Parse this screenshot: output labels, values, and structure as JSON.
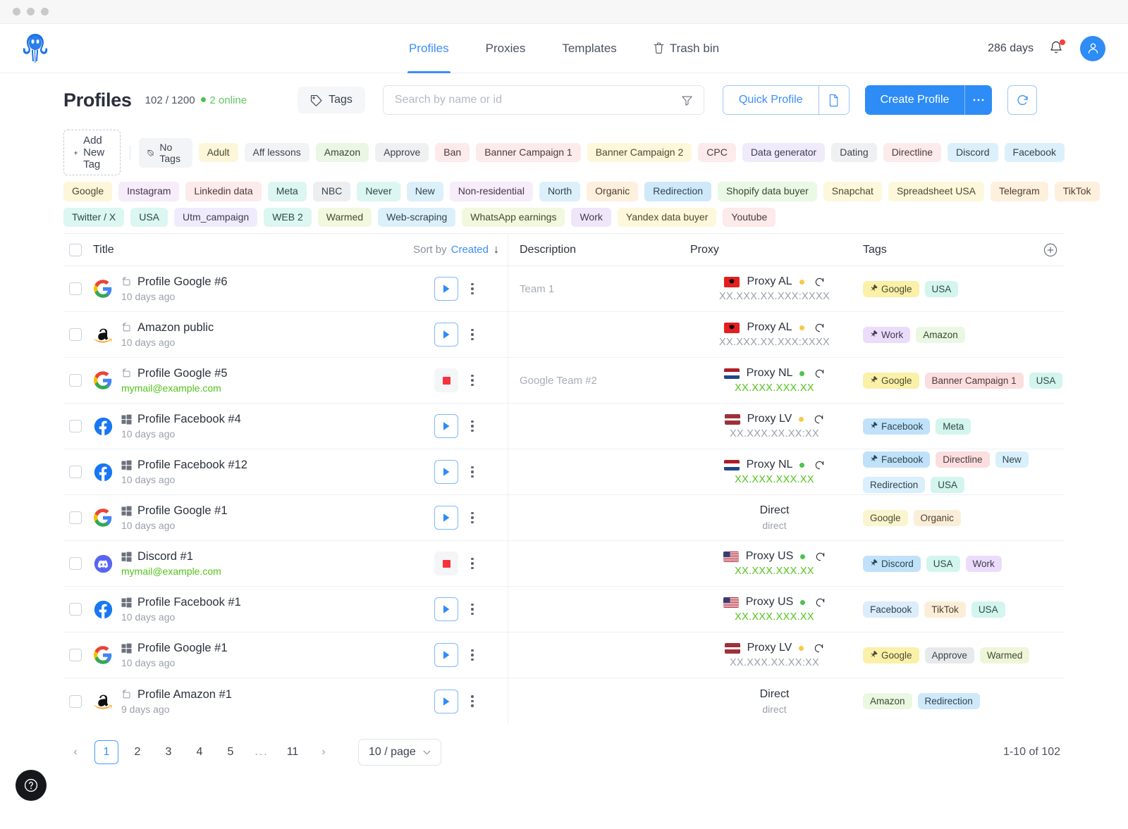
{
  "window": {
    "dots": 3
  },
  "nav": {
    "items": [
      {
        "label": "Profiles",
        "icon": "",
        "active": true
      },
      {
        "label": "Proxies",
        "icon": "",
        "active": false
      },
      {
        "label": "Templates",
        "icon": "",
        "active": false
      },
      {
        "label": "Trash bin",
        "icon": "trash-icon",
        "active": false
      }
    ],
    "days": "286 days",
    "bell_icon": "bell-icon",
    "avatar_icon": "user-icon",
    "logo_icon": "octopus-logo"
  },
  "header": {
    "title": "Profiles",
    "counts": "102 / 1200",
    "online": "2 online",
    "tags_button": "Tags",
    "tags_icon": "tag-icon",
    "search_placeholder": "Search by name or id",
    "search_value": "",
    "filter_icon": "filter-icon",
    "quick_profile": "Quick Profile",
    "quick_profile_icon": "document-icon",
    "create_profile": "Create Profile",
    "create_more_icon": "ellipsis-icon",
    "refresh_icon": "refresh-icon"
  },
  "tag_filters": {
    "add_new_tag": "Add New Tag",
    "add_icon": "plus-icon",
    "no_tags": "No Tags",
    "no_tags_icon": "no-tag-icon",
    "rows": [
      [
        {
          "label": "Adult",
          "bg": "#fdf6d9",
          "fg": "#4b4a32"
        },
        {
          "label": "Aff lessons",
          "bg": "#f2f3f5",
          "fg": "#3c4250"
        },
        {
          "label": "Amazon",
          "bg": "#e9f7e4",
          "fg": "#39482f"
        },
        {
          "label": "Approve",
          "bg": "#eef0f2",
          "fg": "#3c4250"
        },
        {
          "label": "Ban",
          "bg": "#fdeaea",
          "fg": "#50393a"
        },
        {
          "label": "Banner Campaign 1",
          "bg": "#fdeaea",
          "fg": "#50393a"
        },
        {
          "label": "Banner Campaign 2",
          "bg": "#fdf8db",
          "fg": "#4b4a32"
        },
        {
          "label": "CPC",
          "bg": "#fdeaea",
          "fg": "#50393a"
        },
        {
          "label": "Data generator",
          "bg": "#f0ebfb",
          "fg": "#3f3a50"
        },
        {
          "label": "Dating",
          "bg": "#eef0f2",
          "fg": "#3c4250"
        },
        {
          "label": "Directline",
          "bg": "#fdeaea",
          "fg": "#50393a"
        },
        {
          "label": "Discord",
          "bg": "#dcf0fb",
          "fg": "#2f444f"
        },
        {
          "label": "Facebook",
          "bg": "#dcf0fb",
          "fg": "#2f444f"
        }
      ],
      [
        {
          "label": "Google",
          "bg": "#fdf6d9",
          "fg": "#4b4a32"
        },
        {
          "label": "Instagram",
          "bg": "#f6ecfa",
          "fg": "#46354d"
        },
        {
          "label": "Linkedin data",
          "bg": "#fdeaea",
          "fg": "#50393a"
        },
        {
          "label": "Meta",
          "bg": "#dcf6f1",
          "fg": "#2c4a45"
        },
        {
          "label": "NBC",
          "bg": "#eceef0",
          "fg": "#3c4250"
        },
        {
          "label": "Never",
          "bg": "#dcf6f1",
          "fg": "#2c4a45"
        },
        {
          "label": "New",
          "bg": "#dcf0fb",
          "fg": "#2f444f"
        },
        {
          "label": "Non-residential",
          "bg": "#f6ecfa",
          "fg": "#46354d"
        },
        {
          "label": "North",
          "bg": "#dcf0fb",
          "fg": "#2f444f"
        },
        {
          "label": "Organic",
          "bg": "#fdf0dd",
          "fg": "#4d402e"
        },
        {
          "label": "Redirection",
          "bg": "#cfe9fb",
          "fg": "#2f444f"
        },
        {
          "label": "Shopify data buyer",
          "bg": "#eaf8e6",
          "fg": "#39482f"
        },
        {
          "label": "Snapchat",
          "bg": "#fdf8db",
          "fg": "#4b4a32"
        },
        {
          "label": "Spreadsheet USA",
          "bg": "#fdf8db",
          "fg": "#4b4a32"
        },
        {
          "label": "Telegram",
          "bg": "#fdf0dd",
          "fg": "#4d402e"
        },
        {
          "label": "TikTok",
          "bg": "#fdf0dd",
          "fg": "#4d402e"
        }
      ],
      [
        {
          "label": "Twitter / X",
          "bg": "#dcf6f1",
          "fg": "#2c4a45"
        },
        {
          "label": "USA",
          "bg": "#dcf6f1",
          "fg": "#2c4a45"
        },
        {
          "label": "Utm_campaign",
          "bg": "#f0ebfb",
          "fg": "#3f3a50"
        },
        {
          "label": "WEB 2",
          "bg": "#dcf6f1",
          "fg": "#2c4a45"
        },
        {
          "label": "Warmed",
          "bg": "#f2f8dd",
          "fg": "#414a2e"
        },
        {
          "label": "Web-scraping",
          "bg": "#dcf0fb",
          "fg": "#2f444f"
        },
        {
          "label": "WhatsApp earnings",
          "bg": "#f2f8dd",
          "fg": "#414a2e"
        },
        {
          "label": "Work",
          "bg": "#f0e6fb",
          "fg": "#3f3a50"
        },
        {
          "label": "Yandex data buyer",
          "bg": "#fdf8db",
          "fg": "#4b4a32"
        },
        {
          "label": "Youtube",
          "bg": "#fdeaea",
          "fg": "#50393a"
        }
      ]
    ]
  },
  "table": {
    "columns": {
      "title": "Title",
      "sort_label": "Sort by",
      "sort_value": "Created",
      "sort_dir_icon": "arrow-down-icon",
      "description": "Description",
      "proxy": "Proxy",
      "tags": "Tags",
      "add_column_icon": "plus-circle-icon"
    },
    "rows": [
      {
        "brand": "google",
        "os": "mac",
        "name": "Profile Google #6",
        "sub": "10 days ago",
        "sub_type": "time",
        "state": "stopped",
        "description": "Team 1",
        "proxy": {
          "type": "proxy",
          "flag": "al",
          "name": "Proxy AL",
          "status": "yellow",
          "ip": "XX.XXX.XX.XXX:XXXX",
          "ip_green": false
        },
        "tags": [
          {
            "label": "Google",
            "bg": "#fbf0a8",
            "fg": "#4b4a32",
            "pinned": true
          },
          {
            "label": "USA",
            "bg": "#d3f5ee",
            "fg": "#2c4a45",
            "pinned": false
          }
        ]
      },
      {
        "brand": "amazon",
        "os": "mac",
        "name": "Amazon public",
        "sub": "10 days ago",
        "sub_type": "time",
        "state": "stopped",
        "description": "",
        "proxy": {
          "type": "proxy",
          "flag": "al",
          "name": "Proxy AL",
          "status": "yellow",
          "ip": "XX.XXX.XX.XXX:XXXX",
          "ip_green": false
        },
        "tags": [
          {
            "label": "Work",
            "bg": "#ecdcfb",
            "fg": "#3f3a50",
            "pinned": true
          },
          {
            "label": "Amazon",
            "bg": "#eaf8e2",
            "fg": "#39482f",
            "pinned": false
          }
        ]
      },
      {
        "brand": "google",
        "os": "mac",
        "name": "Profile Google #5",
        "sub": "mymail@example.com",
        "sub_type": "mail",
        "state": "running",
        "description": "Google Team #2",
        "proxy": {
          "type": "proxy",
          "flag": "nl",
          "name": "Proxy NL",
          "status": "green",
          "ip": "XX.XXX.XXX.XX",
          "ip_green": true
        },
        "tags": [
          {
            "label": "Google",
            "bg": "#fbf0a8",
            "fg": "#4b4a32",
            "pinned": true
          },
          {
            "label": "Banner Campaign 1",
            "bg": "#fbdedf",
            "fg": "#50393a",
            "pinned": false
          },
          {
            "label": "USA",
            "bg": "#d3f5ee",
            "fg": "#2c4a45",
            "pinned": false
          }
        ]
      },
      {
        "brand": "facebook",
        "os": "win",
        "name": "Profile Facebook #4",
        "sub": "10 days ago",
        "sub_type": "time",
        "state": "stopped",
        "description": "",
        "proxy": {
          "type": "proxy",
          "flag": "lv",
          "name": "Proxy LV",
          "status": "yellow",
          "ip": "XX.XXX.XX.XX:XX",
          "ip_green": false
        },
        "tags": [
          {
            "label": "Facebook",
            "bg": "#bfe2fa",
            "fg": "#2f444f",
            "pinned": true
          },
          {
            "label": "Meta",
            "bg": "#d3f5ee",
            "fg": "#2c4a45",
            "pinned": false
          }
        ]
      },
      {
        "brand": "facebook",
        "os": "win",
        "name": "Profile Facebook #12",
        "sub": "10 days ago",
        "sub_type": "time",
        "state": "stopped",
        "description": "",
        "proxy": {
          "type": "proxy",
          "flag": "nl",
          "name": "Proxy NL",
          "status": "green",
          "ip": "XX.XXX.XXX.XX",
          "ip_green": true
        },
        "tags": [
          {
            "label": "Facebook",
            "bg": "#bfe2fa",
            "fg": "#2f444f",
            "pinned": true
          },
          {
            "label": "Directline",
            "bg": "#fbdedf",
            "fg": "#50393a",
            "pinned": false
          },
          {
            "label": "New",
            "bg": "#d9efFb",
            "fg": "#2f444f",
            "pinned": false
          },
          {
            "label": "Redirection",
            "bg": "#d9effb",
            "fg": "#2f444f",
            "pinned": false
          },
          {
            "label": "USA",
            "bg": "#d3f5ee",
            "fg": "#2c4a45",
            "pinned": false
          }
        ]
      },
      {
        "brand": "google",
        "os": "win",
        "name": "Profile Google #1",
        "sub": "10 days ago",
        "sub_type": "time",
        "state": "stopped",
        "description": "",
        "proxy": {
          "type": "direct",
          "main": "Direct",
          "sub": "direct"
        },
        "tags": [
          {
            "label": "Google",
            "bg": "#fbf5cf",
            "fg": "#4b4a32",
            "pinned": false
          },
          {
            "label": "Organic",
            "bg": "#fbeed8",
            "fg": "#4d402e",
            "pinned": false
          }
        ]
      },
      {
        "brand": "discord",
        "os": "win",
        "name": "Discord #1",
        "sub": "mymail@example.com",
        "sub_type": "mail",
        "state": "running",
        "description": "",
        "proxy": {
          "type": "proxy",
          "flag": "us",
          "name": "Proxy US",
          "status": "green",
          "ip": "XX.XXX.XXX.XX",
          "ip_green": true
        },
        "tags": [
          {
            "label": "Discord",
            "bg": "#bfe2fa",
            "fg": "#2f444f",
            "pinned": true
          },
          {
            "label": "USA",
            "bg": "#d3f5ee",
            "fg": "#2c4a45",
            "pinned": false
          },
          {
            "label": "Work",
            "bg": "#ecdcfb",
            "fg": "#3f3a50",
            "pinned": false
          }
        ]
      },
      {
        "brand": "facebook",
        "os": "win",
        "name": "Profile Facebook #1",
        "sub": "10 days ago",
        "sub_type": "time",
        "state": "stopped",
        "description": "",
        "proxy": {
          "type": "proxy",
          "flag": "us",
          "name": "Proxy US",
          "status": "green",
          "ip": "XX.XXX.XXX.XX",
          "ip_green": true
        },
        "tags": [
          {
            "label": "Facebook",
            "bg": "#dcecfa",
            "fg": "#2f444f",
            "pinned": false
          },
          {
            "label": "TikTok",
            "bg": "#fbeed8",
            "fg": "#4d402e",
            "pinned": false
          },
          {
            "label": "USA",
            "bg": "#d3f5ee",
            "fg": "#2c4a45",
            "pinned": false
          }
        ]
      },
      {
        "brand": "google",
        "os": "win",
        "name": "Profile Google #1",
        "sub": "10 days ago",
        "sub_type": "time",
        "state": "stopped",
        "description": "",
        "proxy": {
          "type": "proxy",
          "flag": "lv",
          "name": "Proxy LV",
          "status": "yellow",
          "ip": "XX.XXX.XX.XX:XX",
          "ip_green": false
        },
        "tags": [
          {
            "label": "Google",
            "bg": "#fbf0a8",
            "fg": "#4b4a32",
            "pinned": true
          },
          {
            "label": "Approve",
            "bg": "#e7e9eb",
            "fg": "#3c4250",
            "pinned": false
          },
          {
            "label": "Warmed",
            "bg": "#eef6da",
            "fg": "#414a2e",
            "pinned": false
          }
        ]
      },
      {
        "brand": "amazon",
        "os": "mac",
        "name": "Profile Amazon #1",
        "sub": "9 days ago",
        "sub_type": "time",
        "state": "stopped",
        "description": "",
        "proxy": {
          "type": "direct",
          "main": "Direct",
          "sub": "direct"
        },
        "tags": [
          {
            "label": "Amazon",
            "bg": "#eaf8e2",
            "fg": "#39482f",
            "pinned": false
          },
          {
            "label": "Redirection",
            "bg": "#cfe9fb",
            "fg": "#2f444f",
            "pinned": false
          }
        ]
      }
    ]
  },
  "pagination": {
    "prev_icon": "chevron-left-icon",
    "next_icon": "chevron-right-icon",
    "pages": [
      "1",
      "2",
      "3",
      "4",
      "5",
      "...",
      "11"
    ],
    "active_page": "1",
    "per_page": "10 / page",
    "per_page_icon": "chevron-down-icon",
    "range": "1-10 of 102"
  },
  "help": {
    "icon": "question-circle-icon"
  }
}
